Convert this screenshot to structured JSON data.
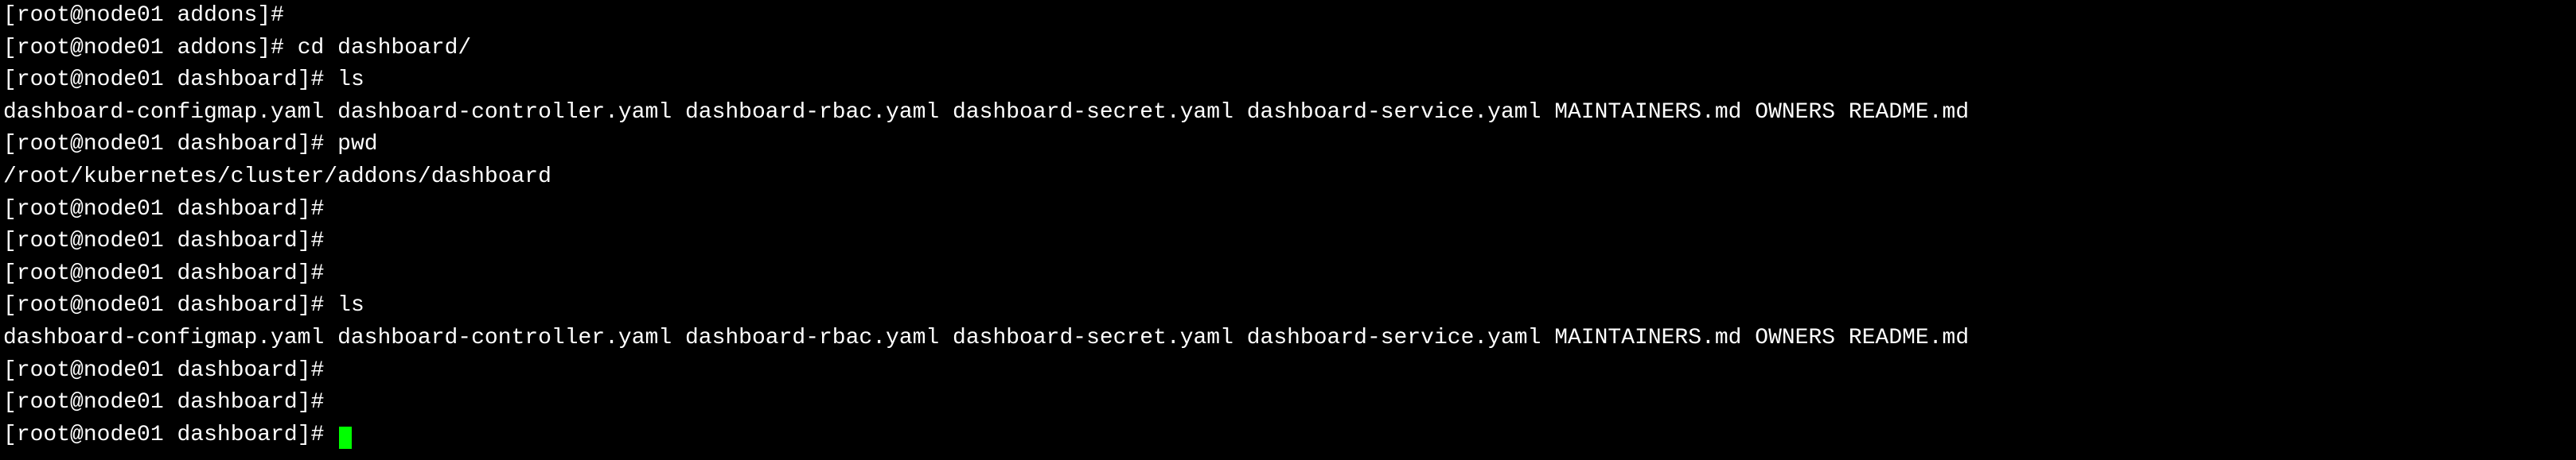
{
  "prompt_prev": {
    "user": "root",
    "host": "node01",
    "dir": "addons"
  },
  "prompt": {
    "user": "root",
    "host": "node01",
    "dir": "dashboard"
  },
  "cmd_cd": "cd dashboard/",
  "cmd_ls": "ls",
  "cmd_pwd": "pwd",
  "pwd_output": "/root/kubernetes/cluster/addons/dashboard",
  "ls_files": [
    "dashboard-configmap.yaml",
    "dashboard-controller.yaml",
    "dashboard-rbac.yaml",
    "dashboard-secret.yaml",
    "dashboard-service.yaml",
    "MAINTAINERS.md",
    "OWNERS",
    "README.md"
  ],
  "col_gap": "   ",
  "hash": "#"
}
